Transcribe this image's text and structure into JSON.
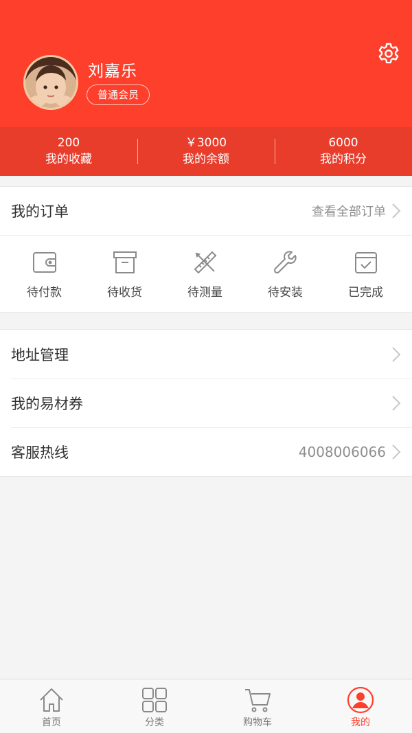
{
  "profile": {
    "name": "刘嘉乐",
    "member_level": "普通会员"
  },
  "stats": [
    {
      "value": "200",
      "label": "我的收藏"
    },
    {
      "value": "￥3000",
      "label": "我的余额"
    },
    {
      "value": "6000",
      "label": "我的积分"
    }
  ],
  "orders": {
    "title": "我的订单",
    "view_all": "查看全部订单",
    "statuses": [
      {
        "label": "待付款",
        "icon": "wallet-icon"
      },
      {
        "label": "待收货",
        "icon": "box-icon"
      },
      {
        "label": "待测量",
        "icon": "ruler-icon"
      },
      {
        "label": "待安装",
        "icon": "wrench-icon"
      },
      {
        "label": "已完成",
        "icon": "calendar-check-icon"
      }
    ]
  },
  "menu": [
    {
      "label": "地址管理",
      "value": ""
    },
    {
      "label": "我的易材券",
      "value": ""
    },
    {
      "label": "客服热线",
      "value": "4008006066"
    }
  ],
  "tabs": [
    {
      "label": "首页",
      "icon": "home-icon"
    },
    {
      "label": "分类",
      "icon": "grid-icon"
    },
    {
      "label": "购物车",
      "icon": "cart-icon"
    },
    {
      "label": "我的",
      "icon": "user-icon",
      "active": true
    }
  ],
  "colors": {
    "brand": "#fd3f2b",
    "stats_bg": "#e93d2c",
    "text_muted": "#8f8f8f"
  }
}
